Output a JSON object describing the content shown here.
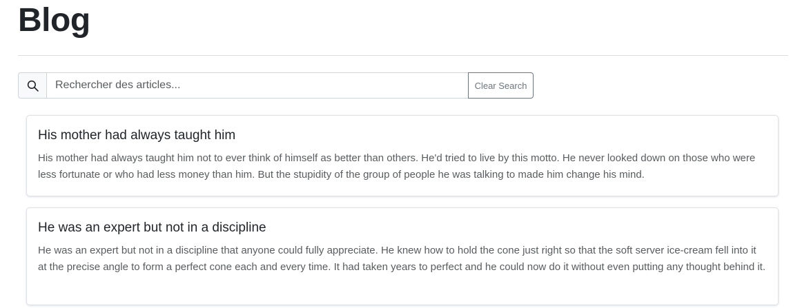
{
  "page": {
    "title": "Blog"
  },
  "search": {
    "icon": "search-icon",
    "placeholder": "Rechercher des articles...",
    "value": "",
    "clear_label": "Clear Search"
  },
  "posts": [
    {
      "title": "His mother had always taught him",
      "body": "His mother had always taught him not to ever think of himself as better than others. He'd tried to live by this motto. He never looked down on those who were less fortunate or who had less money than him. But the stupidity of the group of people he was talking to made him change his mind."
    },
    {
      "title": "He was an expert but not in a discipline",
      "body": "He was an expert but not in a discipline that anyone could fully appreciate. He knew how to hold the cone just right so that the soft server ice-cream fell into it at the precise angle to form a perfect cone each and every time. It had taken years to perfect and he could now do it without even putting any thought behind it."
    }
  ]
}
